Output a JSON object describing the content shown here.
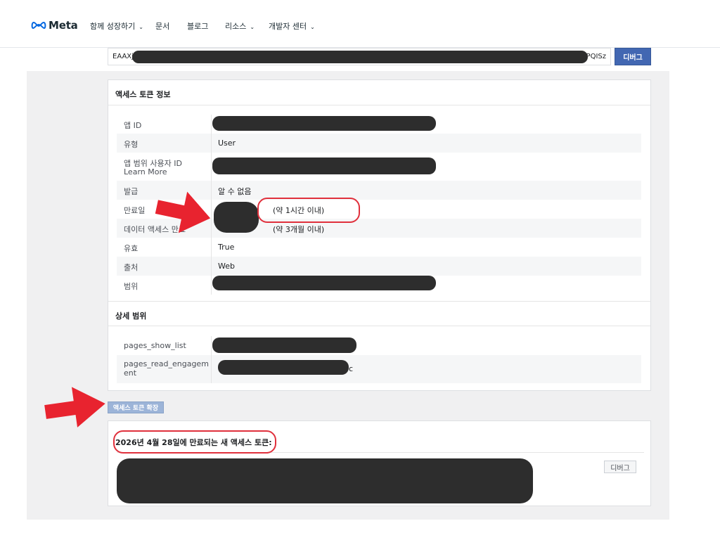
{
  "nav": {
    "logo_text": "Meta",
    "items": [
      {
        "label": "함께 성장하기",
        "has_caret": true
      },
      {
        "label": "문서",
        "has_caret": false
      },
      {
        "label": "블로그",
        "has_caret": false
      },
      {
        "label": "리소스",
        "has_caret": true
      },
      {
        "label": "개발자 센터",
        "has_caret": true
      }
    ],
    "caret_glyph": "⌄"
  },
  "token_input": {
    "prefix": "EAAXj",
    "suffix": "PQISz",
    "debug_label": "디버그"
  },
  "access_token_info": {
    "title": "액세스 토큰 정보",
    "rows": [
      {
        "key": "앱 ID",
        "value": ""
      },
      {
        "key": "유형",
        "value": "User"
      },
      {
        "key": "앱 범위 사용자 ID",
        "key_link": "Learn More",
        "value": ""
      },
      {
        "key": "발급",
        "value": "알 수 없음"
      },
      {
        "key": "만료일",
        "value": "(약 1시간 이내)"
      },
      {
        "key": "데이터 액세스 만료",
        "value": "(약 3개월 이내)"
      },
      {
        "key": "유효",
        "value": "True"
      },
      {
        "key": "출처",
        "value": "Web"
      },
      {
        "key": "범위",
        "value": ""
      }
    ]
  },
  "detail_scopes": {
    "title": "상세 범위",
    "rows": [
      {
        "key": "pages_show_list",
        "value": ""
      },
      {
        "key": "pages_read_engagement",
        "value": "c"
      }
    ]
  },
  "extend_button": "액세스 토큰 확장",
  "new_token": {
    "title": "2026년 4월 28일에 만료되는 새 액세스 토큰:",
    "debug_label": "디버그"
  },
  "colors": {
    "accent": "#4267b2",
    "annotation_red": "#e0303c",
    "redaction": "#2d2d2d",
    "link": "#385898"
  }
}
